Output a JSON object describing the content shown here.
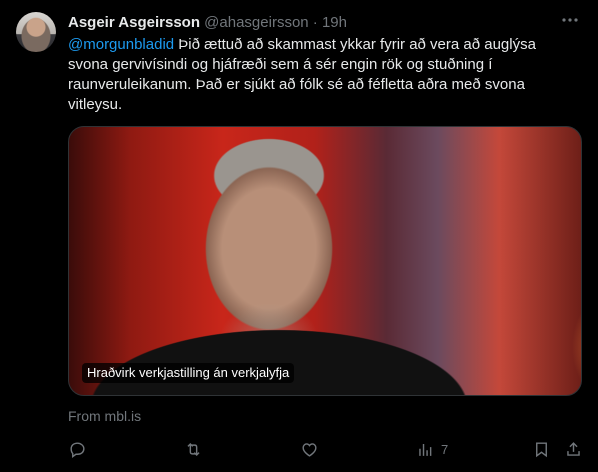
{
  "tweet": {
    "author_name": "Asgeir Asgeirsson",
    "handle": "@ahasgeirsson",
    "separator": "·",
    "time": "19h",
    "mention": "@morgunbladid",
    "text_line1": " Þið ættuð að skammast ykkar fyrir að vera að auglýsa",
    "text_line2": "svona gervivísindi og hjáfræði sem á sér engin rök og stuðning í",
    "text_line3": "raunveruleikanum. Það er sjúkt að fólk sé að féfletta aðra með svona",
    "text_line4": "vitleysu."
  },
  "card": {
    "caption": "Hraðvirk verkjastilling án verkjalyfja",
    "source": "From mbl.is"
  },
  "actions": {
    "reply_icon": "reply-icon",
    "retweet_icon": "retweet-icon",
    "like_icon": "heart-icon",
    "views_icon": "analytics-icon",
    "views_count": "7",
    "bookmark_icon": "bookmark-icon",
    "share_icon": "share-icon"
  },
  "more_icon": "more-icon"
}
